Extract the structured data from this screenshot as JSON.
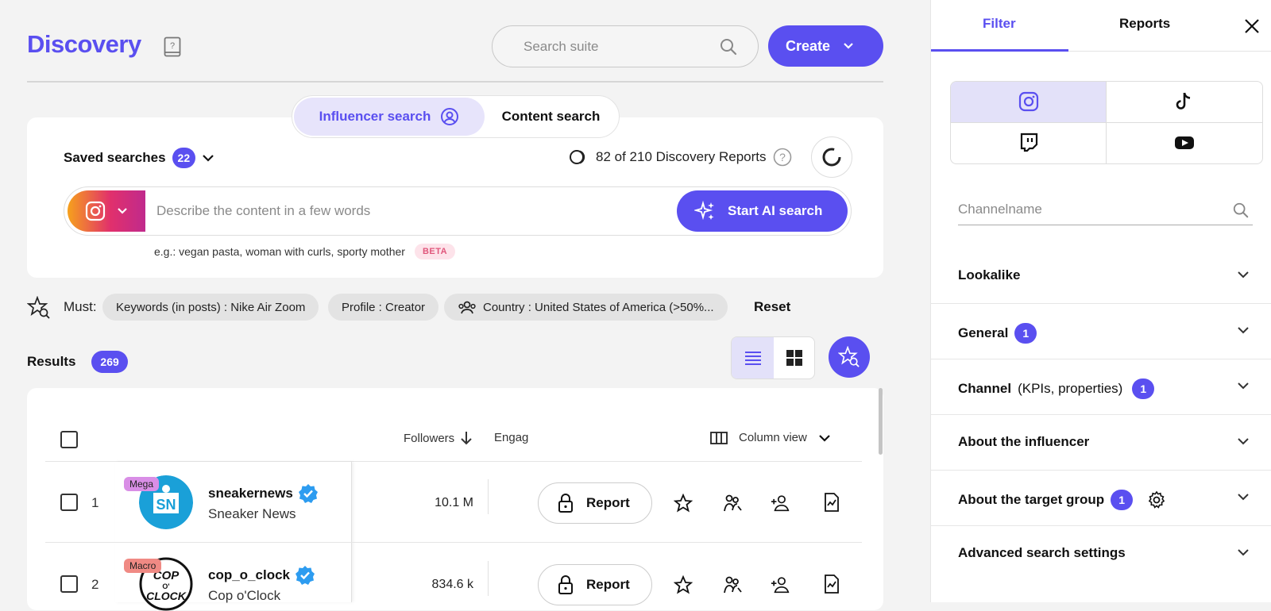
{
  "header": {
    "title": "Discovery",
    "search_placeholder": "Search suite",
    "create_label": "Create"
  },
  "mode_toggle": {
    "influencer": "Influencer search",
    "content": "Content search"
  },
  "saved": {
    "label": "Saved searches",
    "count": "22"
  },
  "reports_counter": "82 of 210 Discovery Reports",
  "ai_search": {
    "placeholder": "Describe the content in a few words",
    "button": "Start AI search",
    "example": "e.g.: vegan pasta, woman with curls, sporty mother",
    "beta": "BETA"
  },
  "filters": {
    "must_label": "Must:",
    "chips": [
      "Keywords (in posts) : Nike Air Zoom",
      "Profile : Creator",
      "Country : United States of America (>50%..."
    ],
    "reset": "Reset"
  },
  "results": {
    "label": "Results",
    "count": "269"
  },
  "table": {
    "headers": {
      "followers": "Followers",
      "engagement": "Engag",
      "column_view": "Column view"
    },
    "rows": [
      {
        "index": "1",
        "tier": "Mega",
        "username": "sneakernews",
        "display_name": "Sneaker News",
        "followers": "10.1 M",
        "report": "Report"
      },
      {
        "index": "2",
        "tier": "Macro",
        "username": "cop_o_clock",
        "display_name": "Cop o'Clock",
        "followers": "834.6 k",
        "report": "Report"
      }
    ]
  },
  "sidebar": {
    "tabs": [
      "Filter",
      "Reports"
    ],
    "channel_placeholder": "Channelname",
    "sections": [
      {
        "label": "Lookalike",
        "extra": "",
        "badge": ""
      },
      {
        "label": "General",
        "extra": "",
        "badge": "1"
      },
      {
        "label": "Channel",
        "extra": "(KPIs, properties)",
        "badge": "1"
      },
      {
        "label": "About the influencer",
        "extra": "",
        "badge": ""
      },
      {
        "label": "About the target group",
        "extra": "",
        "badge": "1"
      },
      {
        "label": "Advanced search settings",
        "extra": "",
        "badge": ""
      }
    ]
  },
  "colors": {
    "accent": "#5a4ff0",
    "accent_light": "#e7e4fb",
    "mega_tag": "#d98ee6",
    "macro_tag": "#f08a84",
    "beta_bg": "#fde3ea"
  }
}
